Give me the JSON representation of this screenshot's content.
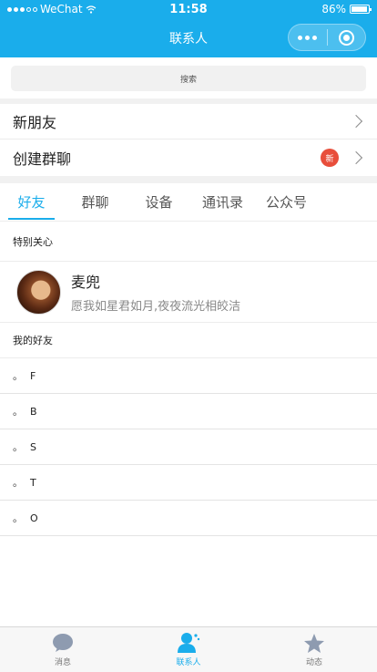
{
  "status_bar": {
    "carrier": "WeChat",
    "time": "11:58",
    "battery": "86%"
  },
  "nav": {
    "title": "联系人"
  },
  "search": {
    "placeholder": "搜索"
  },
  "menu": {
    "new_friends": "新朋友",
    "create_group": "创建群聊",
    "new_badge": "新"
  },
  "tabs": [
    "好友",
    "群聊",
    "设备",
    "通讯录",
    "公众号"
  ],
  "special": {
    "title": "特别关心",
    "friend": {
      "name": "麦兜",
      "signature": "愿我如星君如月,夜夜流光相皎洁"
    }
  },
  "my_friends": {
    "title": "我的好友",
    "bullet": "。",
    "groups": [
      "F",
      "B",
      "S",
      "T",
      "O"
    ]
  },
  "tabbar": {
    "items": [
      "消息",
      "联系人",
      "动态"
    ]
  },
  "colors": {
    "primary": "#1AADEB",
    "badge": "#E84E3B",
    "background": "#F1F1F1"
  }
}
